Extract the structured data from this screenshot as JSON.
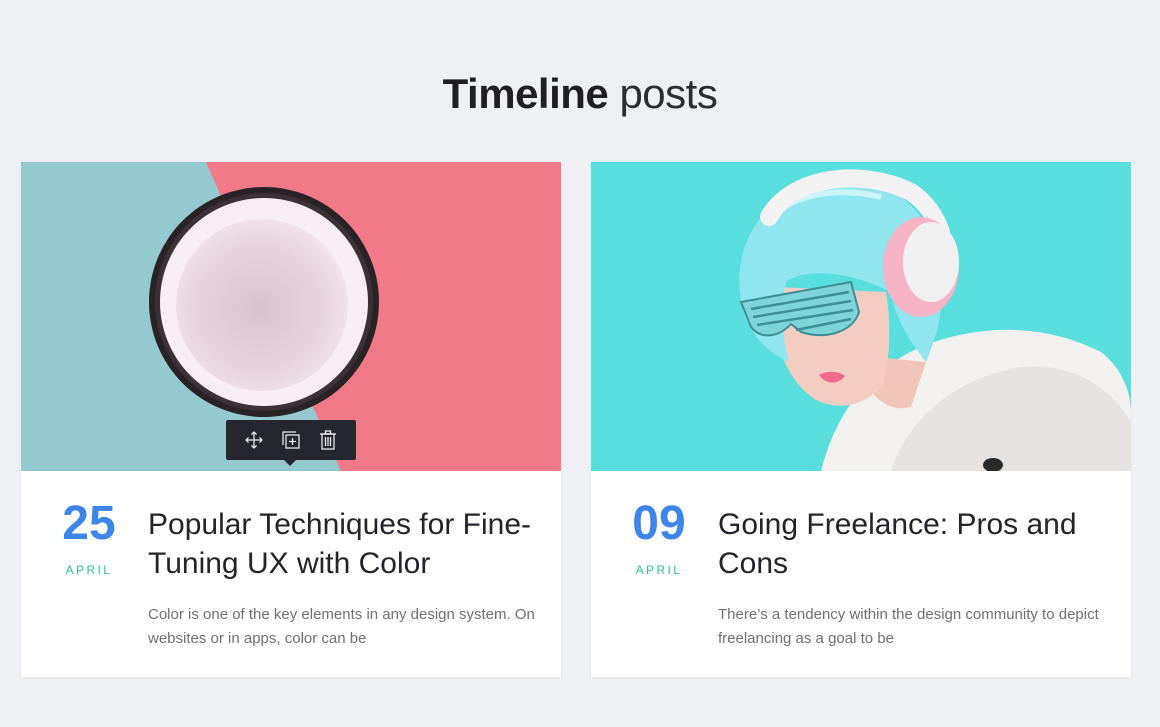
{
  "section": {
    "title_strong": "Timeline",
    "title_light": " posts"
  },
  "posts": [
    {
      "day": "25",
      "month": "APRIL",
      "title": "Popular Techniques for Fine-Tuning UX with Color",
      "excerpt": "Color is one of the key elements in any design system. On websites or in apps, color can be",
      "image": "coconut-half-on-blue-pink-background"
    },
    {
      "day": "09",
      "month": "APRIL",
      "title": "Going Freelance: Pros and Cons",
      "excerpt": "There’s a tendency within the design community to depict freelancing as a goal to be",
      "image": "woman-with-headphones-and-shutter-shades"
    }
  ],
  "toolbar": {
    "icons": [
      "move-icon",
      "duplicate-icon",
      "trash-icon"
    ]
  },
  "colors": {
    "page_bg": "#eff0f4",
    "date_blue": "#3d86e8",
    "month_green": "#27c39a",
    "toolbar_bg": "#26262e"
  }
}
